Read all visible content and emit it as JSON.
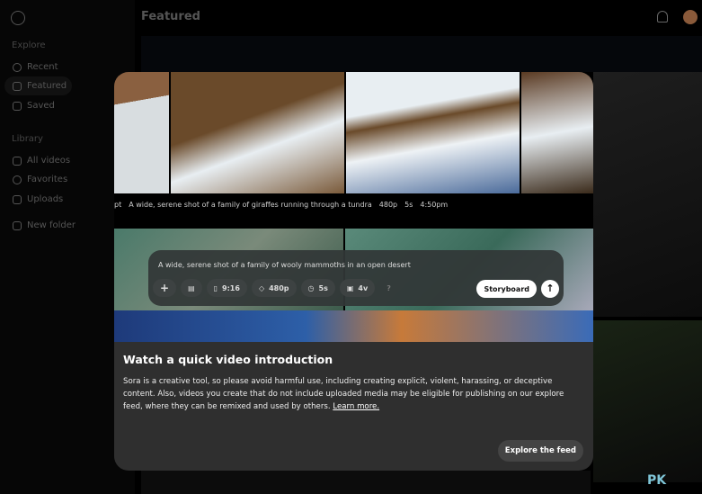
{
  "sidebar": {
    "explore_label": "Explore",
    "library_label": "Library",
    "explore_items": [
      {
        "label": "Recent",
        "icon": "play-circle-icon"
      },
      {
        "label": "Featured",
        "icon": "star-icon"
      },
      {
        "label": "Saved",
        "icon": "bookmark-icon"
      }
    ],
    "library_items": [
      {
        "label": "All videos",
        "icon": "video-icon"
      },
      {
        "label": "Favorites",
        "icon": "heart-icon"
      },
      {
        "label": "Uploads",
        "icon": "upload-icon"
      }
    ],
    "new_folder": "New folder"
  },
  "header": {
    "title": "Featured"
  },
  "preview": {
    "caption_prefix": "pt",
    "caption": "A wide, serene shot of a family of giraffes running through a tundra",
    "resolution": "480p",
    "duration": "5s",
    "time": "4:50pm"
  },
  "prompt": {
    "text": "A wide, serene shot of a family of wooly mammoths in an open desert",
    "aspect": "9:16",
    "resolution": "480p",
    "duration": "5s",
    "variations": "4v",
    "help": "?",
    "storyboard": "Storyboard",
    "add": "+",
    "send": "↑"
  },
  "modal": {
    "title": "Watch a quick video introduction",
    "body": "Sora is a creative tool, so please avoid harmful use, including creating explicit, violent, harassing, or deceptive content. Also, videos you create that do not include uploaded media may be eligible for publishing on our explore feed, where they can be remixed and used by others.",
    "learn_more": "Learn more.",
    "explore_button": "Explore the feed"
  },
  "watermark": "PK"
}
